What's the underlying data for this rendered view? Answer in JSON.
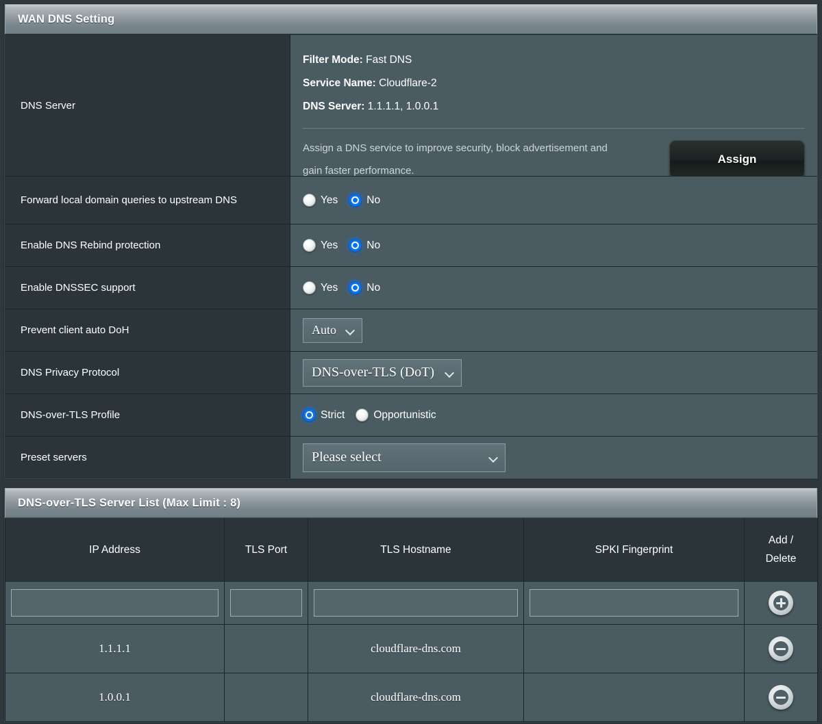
{
  "theme": {
    "panel_bg": "#2b3539",
    "value_bg": "#4a5b61",
    "accent_blue": "#0a74ef",
    "text": "#ffffff",
    "muted_text": "#cfd6d8",
    "border": "#1d2427"
  },
  "wan_dns_panel": {
    "title": "WAN DNS Setting",
    "dns_server": {
      "label": "DNS Server",
      "filter_mode_key": "Filter Mode:",
      "filter_mode_value": "Fast DNS",
      "service_name_key": "Service Name:",
      "service_name_value": "Cloudflare-2",
      "dns_server_key": "DNS Server:",
      "dns_server_value": "1.1.1.1, 1.0.0.1",
      "description": "Assign a DNS service to improve security, block advertisement and gain faster performance.",
      "assign_button": "Assign"
    },
    "forward_local": {
      "label": "Forward local domain queries to upstream DNS",
      "options": [
        "Yes",
        "No"
      ],
      "selected": "No"
    },
    "dns_rebind": {
      "label": "Enable DNS Rebind protection",
      "options": [
        "Yes",
        "No"
      ],
      "selected": "No"
    },
    "dnssec": {
      "label": "Enable DNSSEC support",
      "options": [
        "Yes",
        "No"
      ],
      "selected": "No"
    },
    "prevent_doh": {
      "label": "Prevent client auto DoH",
      "value": "Auto"
    },
    "privacy_protocol": {
      "label": "DNS Privacy Protocol",
      "value": "DNS-over-TLS (DoT)"
    },
    "dot_profile": {
      "label": "DNS-over-TLS Profile",
      "options": [
        "Strict",
        "Opportunistic"
      ],
      "selected": "Strict"
    },
    "preset_servers": {
      "label": "Preset servers",
      "value": "Please select"
    }
  },
  "server_list_panel": {
    "title": "DNS-over-TLS Server List (Max Limit : 8)",
    "columns": [
      "IP Address",
      "TLS Port",
      "TLS Hostname",
      "SPKI Fingerprint",
      "Add /\nDelete"
    ],
    "column_action_line1": "Add /",
    "column_action_line2": "Delete",
    "new_row": {
      "ip_address": "",
      "tls_port": "",
      "tls_hostname": "",
      "spki_fingerprint": "",
      "add_icon": "plus-circle-icon"
    },
    "rows": [
      {
        "ip_address": "1.1.1.1",
        "tls_port": "",
        "tls_hostname": "cloudflare-dns.com",
        "spki_fingerprint": "",
        "delete_icon": "minus-circle-icon"
      },
      {
        "ip_address": "1.0.0.1",
        "tls_port": "",
        "tls_hostname": "cloudflare-dns.com",
        "spki_fingerprint": "",
        "delete_icon": "minus-circle-icon"
      }
    ]
  }
}
